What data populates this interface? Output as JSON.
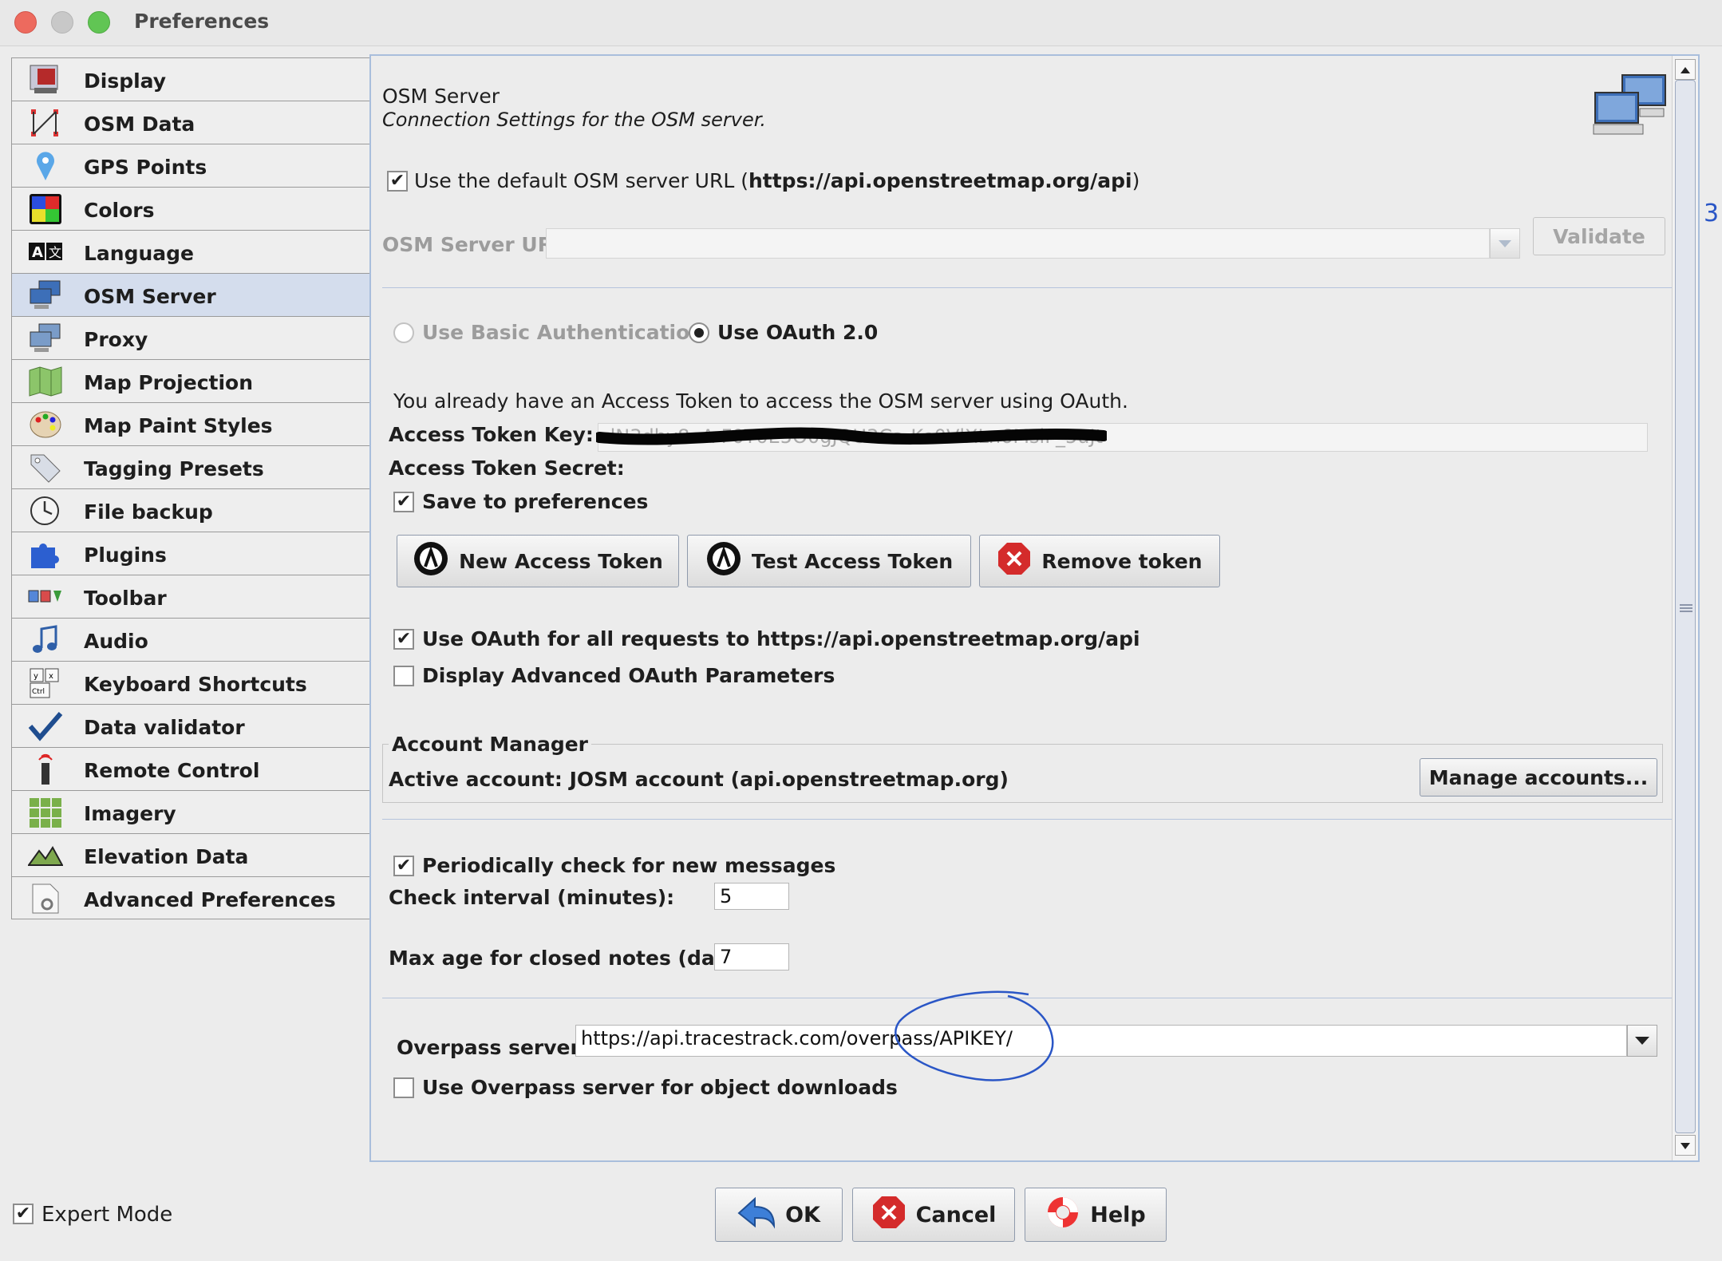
{
  "window": {
    "title": "Preferences"
  },
  "sidebar": {
    "items": [
      {
        "label": "Display",
        "icon": "display-icon"
      },
      {
        "label": "OSM Data",
        "icon": "osm-data-icon"
      },
      {
        "label": "GPS Points",
        "icon": "gps-pin-icon"
      },
      {
        "label": "Colors",
        "icon": "colors-icon"
      },
      {
        "label": "Language",
        "icon": "language-icon"
      },
      {
        "label": "OSM Server",
        "icon": "osm-server-icon",
        "selected": true
      },
      {
        "label": "Proxy",
        "icon": "proxy-icon"
      },
      {
        "label": "Map Projection",
        "icon": "map-projection-icon"
      },
      {
        "label": "Map Paint Styles",
        "icon": "palette-icon"
      },
      {
        "label": "Tagging Presets",
        "icon": "tag-icon"
      },
      {
        "label": "File backup",
        "icon": "clock-icon"
      },
      {
        "label": "Plugins",
        "icon": "plugin-icon"
      },
      {
        "label": "Toolbar",
        "icon": "toolbar-icon"
      },
      {
        "label": "Audio",
        "icon": "music-note-icon"
      },
      {
        "label": "Keyboard Shortcuts",
        "icon": "keyboard-icon"
      },
      {
        "label": "Data validator",
        "icon": "checkmark-icon"
      },
      {
        "label": "Remote Control",
        "icon": "remote-control-icon"
      },
      {
        "label": "Imagery",
        "icon": "imagery-grid-icon"
      },
      {
        "label": "Elevation Data",
        "icon": "elevation-icon"
      },
      {
        "label": "Advanced Preferences",
        "icon": "advanced-icon"
      }
    ]
  },
  "header": {
    "title": "OSM Server",
    "subtitle": "Connection Settings for the OSM server."
  },
  "server": {
    "use_default_prefix": "Use the default OSM server URL (",
    "use_default_url": "https://api.openstreetmap.org/api",
    "use_default_suffix": ")",
    "use_default_checked": true,
    "url_label": "OSM Server URL:",
    "url_value": "",
    "validate_label": "Validate"
  },
  "auth": {
    "basic_label": "Use Basic Authentication",
    "oauth_label": "Use OAuth 2.0",
    "selected": "oauth"
  },
  "token": {
    "info": "You already have an Access Token to access the OSM server using OAuth.",
    "key_label": "Access Token Key:",
    "key_value": "dN3dhy8oA-F0T0E5O0gJQU3Ca-Ke0VlXLn6MslF_5uJt",
    "secret_label": "Access Token Secret:",
    "save_label": "Save to preferences",
    "save_checked": true,
    "new_label": "New Access Token",
    "test_label": "Test Access Token",
    "remove_label": "Remove token"
  },
  "oauth_opts": {
    "all_requests_prefix": "Use OAuth for all requests to ",
    "all_requests_url": "https://api.openstreetmap.org/api",
    "all_requests_checked": true,
    "advanced_label": "Display Advanced OAuth Parameters",
    "advanced_checked": false
  },
  "account": {
    "group_title": "Account Manager",
    "active_label": "Active account: JOSM account (api.openstreetmap.org)",
    "manage_label": "Manage accounts..."
  },
  "messages": {
    "periodic_label": "Periodically check for new messages",
    "periodic_checked": true,
    "interval_label": "Check interval (minutes):",
    "interval_value": "5",
    "maxage_label": "Max age for closed notes (days):",
    "maxage_value": "7"
  },
  "overpass": {
    "server_label": "Overpass server:",
    "server_value": "https://api.tracestrack.com/overpass/APIKEY/",
    "use_label": "Use Overpass server for object downloads",
    "use_checked": false
  },
  "bottom": {
    "expert_label": "Expert Mode",
    "expert_checked": true,
    "ok_label": "OK",
    "cancel_label": "Cancel",
    "help_label": "Help"
  },
  "colors": {
    "selected_bg": "#d4dded",
    "panel_border": "#a9bedc",
    "annotation": "#2a56c6"
  }
}
